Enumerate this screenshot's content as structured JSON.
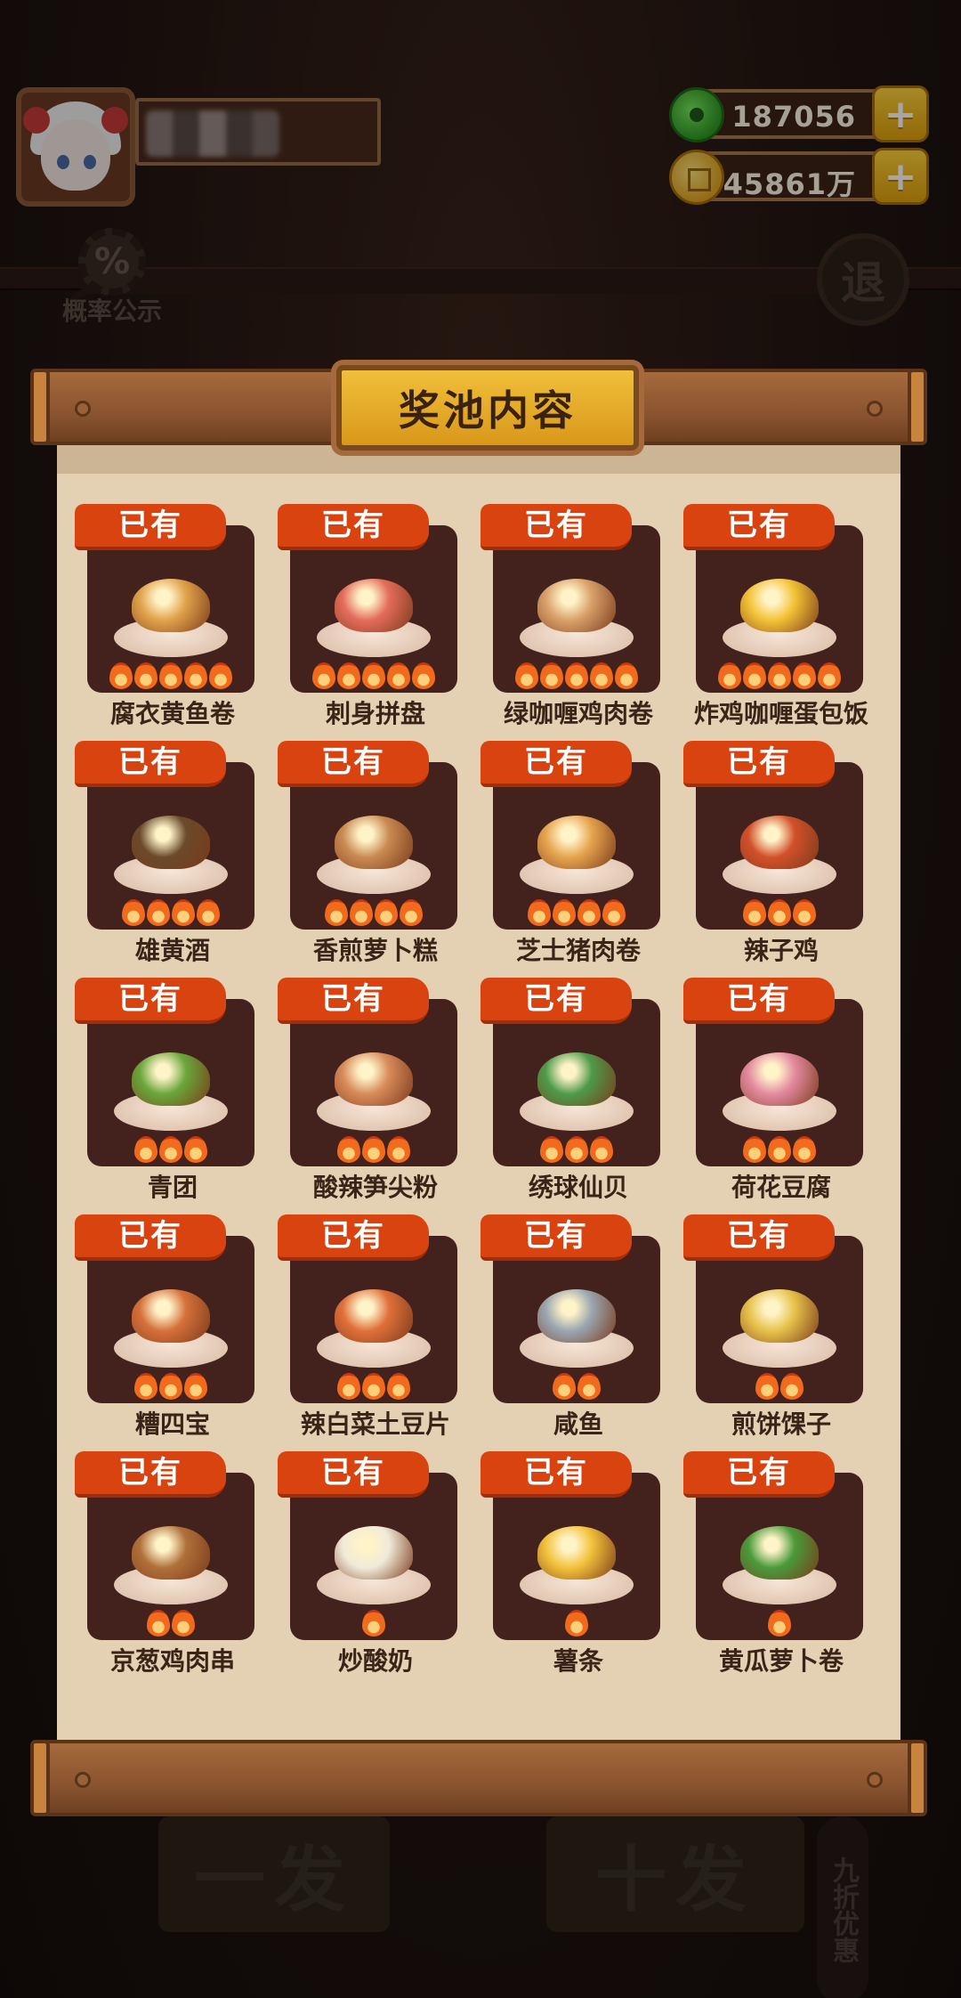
{
  "player": {
    "name_hidden": true
  },
  "resources": {
    "jade": "187056",
    "coins": "45861万",
    "add_label": "+"
  },
  "side_buttons": {
    "probability": "概率公示",
    "probability_icon": "%",
    "exit": "退"
  },
  "background_buttons": {
    "single": "一发",
    "ten": "十发",
    "discount": "九折优惠"
  },
  "panel": {
    "title": "奖池内容"
  },
  "owned_label": "已有",
  "dishes": [
    {
      "name": "腐衣黄鱼卷",
      "flames": 5,
      "color": "#e0a24a"
    },
    {
      "name": "刺身拼盘",
      "flames": 5,
      "color": "#e46b5a"
    },
    {
      "name": "绿咖喱鸡肉卷",
      "flames": 5,
      "color": "#d8a06a"
    },
    {
      "name": "炸鸡咖喱蛋包饭",
      "flames": 5,
      "color": "#f3c235"
    },
    {
      "name": "雄黄酒",
      "flames": 4,
      "color": "#6a4a2a"
    },
    {
      "name": "香煎萝卜糕",
      "flames": 4,
      "color": "#c98a52"
    },
    {
      "name": "芝士猪肉卷",
      "flames": 4,
      "color": "#e6a44e"
    },
    {
      "name": "辣子鸡",
      "flames": 3,
      "color": "#d2502a"
    },
    {
      "name": "青团",
      "flames": 3,
      "color": "#6aa63a"
    },
    {
      "name": "酸辣笋尖粉",
      "flames": 3,
      "color": "#d88a5a"
    },
    {
      "name": "绣球仙贝",
      "flames": 3,
      "color": "#4e9a4a"
    },
    {
      "name": "荷花豆腐",
      "flames": 3,
      "color": "#e48aa0"
    },
    {
      "name": "糟四宝",
      "flames": 3,
      "color": "#d6703a"
    },
    {
      "name": "辣白菜土豆片",
      "flames": 3,
      "color": "#e0703a"
    },
    {
      "name": "咸鱼",
      "flames": 2,
      "color": "#9aa6b0"
    },
    {
      "name": "煎饼馃子",
      "flames": 2,
      "color": "#e6c24a"
    },
    {
      "name": "京葱鸡肉串",
      "flames": 2,
      "color": "#b0703a"
    },
    {
      "name": "炒酸奶",
      "flames": 1,
      "color": "#f0ead8"
    },
    {
      "name": "薯条",
      "flames": 1,
      "color": "#f2c23a"
    },
    {
      "name": "黄瓜萝卜卷",
      "flames": 1,
      "color": "#4a9a3a"
    }
  ]
}
